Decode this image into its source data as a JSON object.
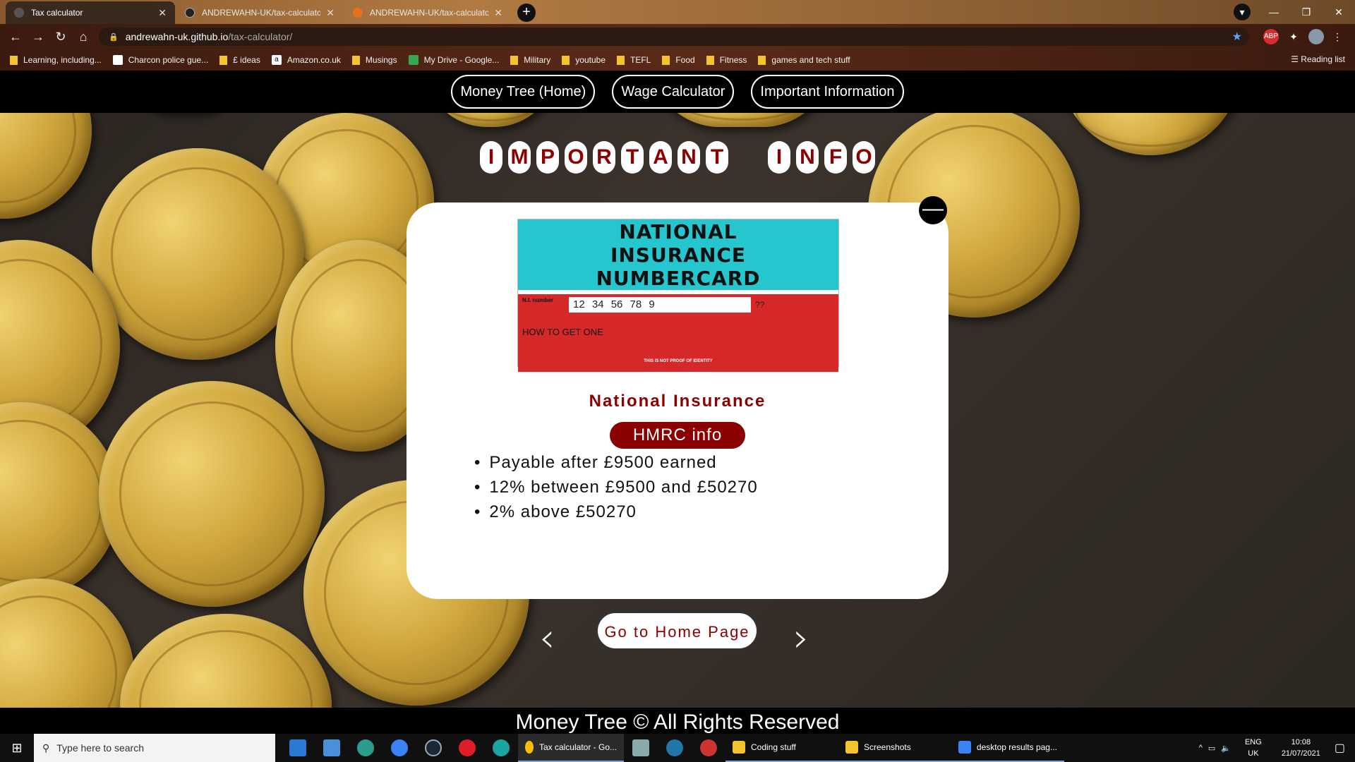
{
  "browser": {
    "tabs": [
      {
        "label": "Tax calculator",
        "active": true
      },
      {
        "label": "ANDREWAHN-UK/tax-calculator",
        "active": false
      },
      {
        "label": "ANDREWAHN-UK/tax-calculator",
        "active": false
      }
    ],
    "url_host": "andrewahn-uk.github.io",
    "url_path": "/tax-calculator/",
    "bookmarks": [
      "Learning, including...",
      "Charcon police gue...",
      "£ ideas",
      "Amazon.co.uk",
      "Musings",
      "My Drive - Google...",
      "Military",
      "youtube",
      "TEFL",
      "Food",
      "Fitness",
      "games and tech stuff"
    ],
    "reading_list": "Reading list"
  },
  "nav": {
    "home": "Money Tree (Home)",
    "wage": "Wage Calculator",
    "info": "Important Information"
  },
  "heading": {
    "word1": [
      "I",
      "M",
      "P",
      "O",
      "R",
      "T",
      "A",
      "N",
      "T"
    ],
    "word2": [
      "I",
      "N",
      "F",
      "O"
    ]
  },
  "card": {
    "image": {
      "title_lines": [
        "NATIONAL",
        "INSURANCE",
        "NUMBERCARD"
      ],
      "ni_label": "N.I. number",
      "ni_value": "12 34 56 78 9",
      "suffix": "??",
      "how_to": "HOW TO GET ONE",
      "proof": "THIS IS NOT PROOF OF IDENTITY"
    },
    "title": "National Insurance",
    "hmrc_button": "HMRC info",
    "bullets": [
      "Payable after £9500 earned",
      "12% between £9500 and £50270",
      "2% above £50270"
    ],
    "collapse_symbol": "—"
  },
  "controls": {
    "prev": "‹",
    "next": "›",
    "home_button": "Go to Home Page"
  },
  "footer": "Money Tree © All Rights Reserved",
  "taskbar": {
    "search_placeholder": "Type here to search",
    "windows": [
      "Tax calculator - Go...",
      "Coding stuff",
      "Screenshots",
      "desktop results pag..."
    ],
    "lang": "ENG",
    "region": "UK",
    "time": "10:08",
    "date": "21/07/2021"
  }
}
